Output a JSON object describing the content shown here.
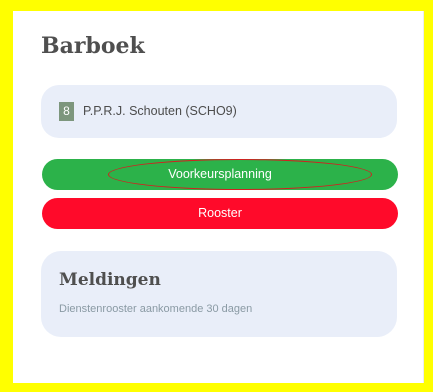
{
  "app": {
    "title": "Barboek"
  },
  "user": {
    "badge": "8",
    "name": "P.P.R.J. Schouten (SCHO9)"
  },
  "actions": {
    "voorkeur_label": "Voorkeursplanning",
    "rooster_label": "Rooster"
  },
  "notifications": {
    "title": "Meldingen",
    "subtitle": "Dienstenrooster aankomende 30 dagen"
  },
  "colors": {
    "frame": "#ffff00",
    "card": "#e9eef9",
    "voorkeur": "#2cb24a",
    "rooster": "#ff0a2a",
    "highlight": "#d22020"
  }
}
